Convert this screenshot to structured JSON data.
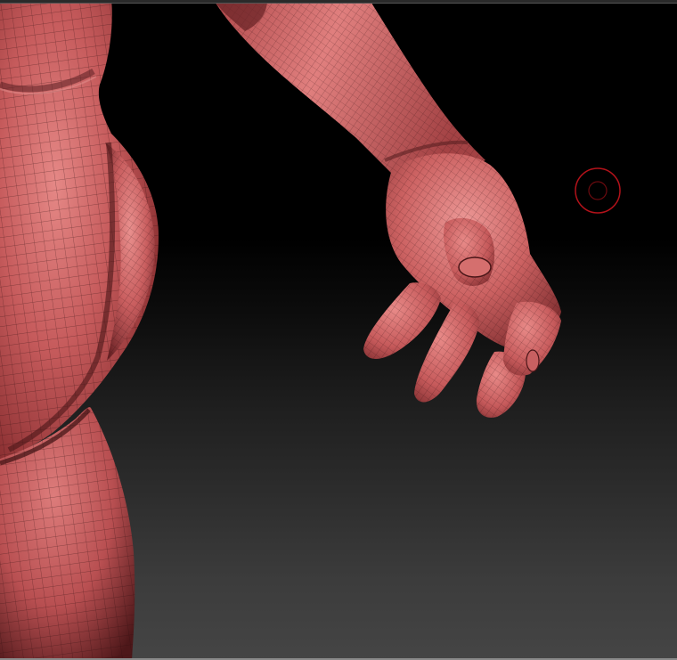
{
  "viewport": {
    "background_top": "#000000",
    "background_bottom": "#454545"
  },
  "model": {
    "material_color": "#c4595a",
    "highlight_color": "#e88a88",
    "shadow_color": "#5a1f22",
    "wire_color": "#2b0c0e"
  },
  "brush_cursor": {
    "ring_color": "#b3121a",
    "icon": "brush-cursor-icon"
  }
}
